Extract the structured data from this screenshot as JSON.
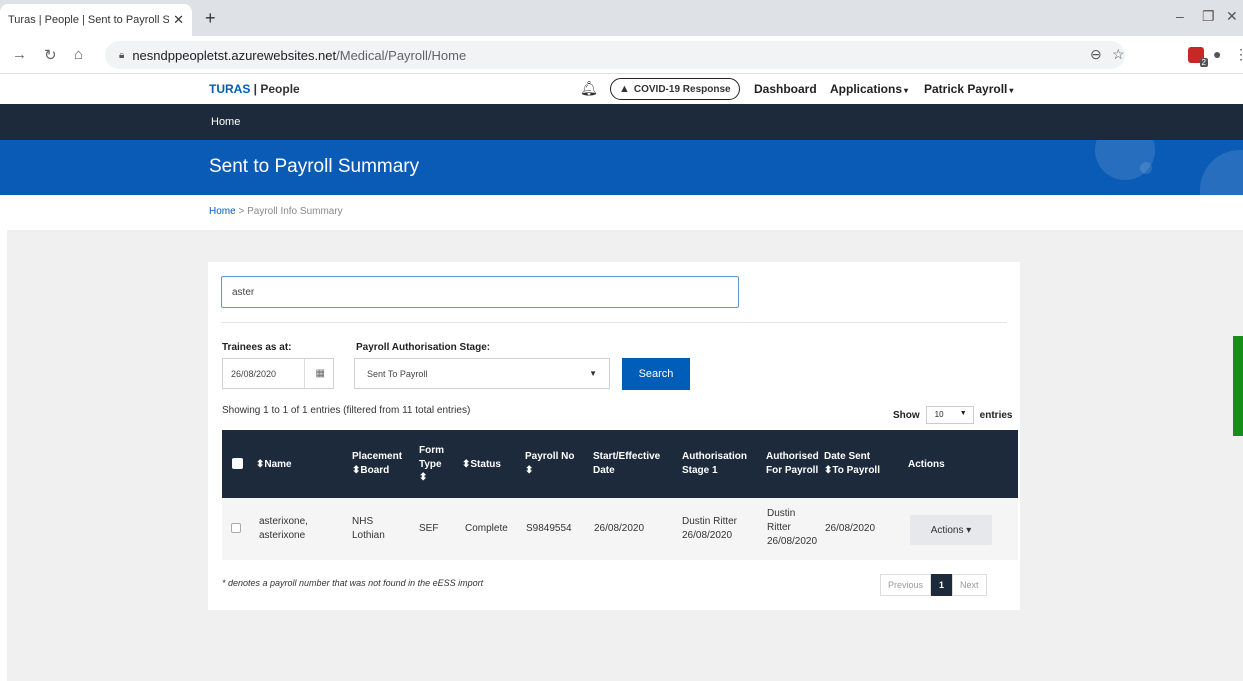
{
  "browser": {
    "tab_title": "Turas | People | Sent to Payroll Su",
    "url_host": "nesndppeopletst.azurewebsites.net",
    "url_path": "/Medical/Payroll/Home",
    "extension_badge": "2"
  },
  "header": {
    "brand_turas": "TURAS",
    "brand_people": " | People",
    "covid_label": "COVID-19 Response",
    "nav": [
      "Dashboard",
      "Applications",
      "Patrick Payroll"
    ]
  },
  "topbar": {
    "home": "Home"
  },
  "banner": {
    "title": "Sent to Payroll Summary"
  },
  "breadcrumb": {
    "home": "Home",
    "separator": " > ",
    "current": "Payroll Info Summary"
  },
  "filters": {
    "search_value": "aster",
    "trainees_label": "Trainees as at:",
    "trainees_value": "26/08/2020",
    "stage_label": "Payroll Authorisation Stage:",
    "stage_value": "Sent To Payroll",
    "search_button": "Search"
  },
  "table_info": {
    "showing": "Showing 1 to 1 of 1 entries (filtered from 11 total entries)",
    "show_label": "Show",
    "page_size": "10",
    "entries_label": "entries"
  },
  "table": {
    "headers": {
      "name": "⬍Name",
      "placement": "Placement\n⬍Board",
      "form_type": "Form\nType\n⬍",
      "status": "⬍Status",
      "payroll_no": "Payroll No\n⬍",
      "start_date": "Start/Effective\nDate",
      "auth_stage": "Authorisation\nStage 1",
      "authorised": "Authorised\nFor Payroll",
      "date_sent": "Date Sent\n⬍To Payroll",
      "actions": "Actions"
    },
    "rows": [
      {
        "name": "asterixone,\nasterixone",
        "placement": "NHS\nLothian",
        "form_type": "SEF",
        "status": "Complete",
        "payroll_no": "S9849554",
        "start_date": "26/08/2020",
        "auth_stage": "Dustin Ritter\n26/08/2020",
        "authorised": "Dustin\nRitter\n26/08/2020",
        "date_sent": "26/08/2020",
        "actions_button": "Actions ▾"
      }
    ]
  },
  "footer": {
    "note": "* denotes a payroll number that was not found in the eESS import",
    "pager": {
      "previous": "Previous",
      "page": "1",
      "next": "Next"
    }
  }
}
